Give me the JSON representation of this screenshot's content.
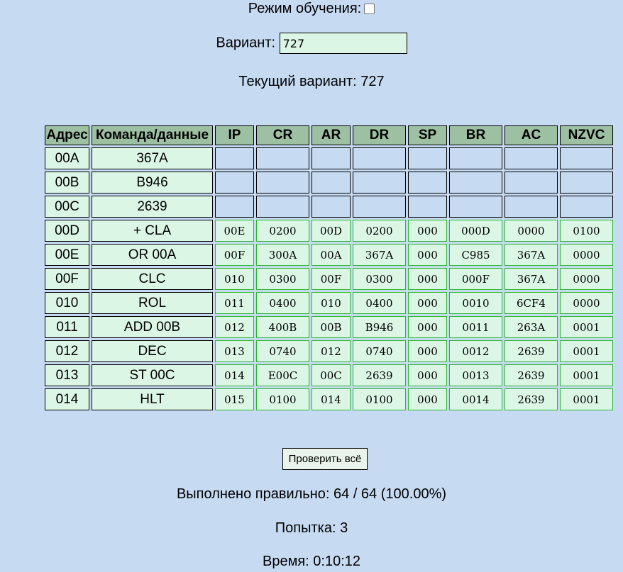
{
  "training_mode": {
    "label": "Режим обучения:",
    "checked": false
  },
  "variant": {
    "label": "Вариант:",
    "value": "727"
  },
  "current_variant": {
    "label": "Текущий вариант:",
    "value": "727"
  },
  "table": {
    "headers": [
      "Адрес",
      "Команда/данные",
      "IP",
      "CR",
      "AR",
      "DR",
      "SP",
      "BR",
      "AC",
      "NZVC"
    ],
    "rows": [
      {
        "addr": "00A",
        "cmd": "367A",
        "vals": []
      },
      {
        "addr": "00B",
        "cmd": "B946",
        "vals": []
      },
      {
        "addr": "00C",
        "cmd": "2639",
        "vals": []
      },
      {
        "addr": "00D",
        "cmd": "+ CLA",
        "vals": [
          "00E",
          "0200",
          "00D",
          "0200",
          "000",
          "000D",
          "0000",
          "0100"
        ]
      },
      {
        "addr": "00E",
        "cmd": "OR 00A",
        "vals": [
          "00F",
          "300A",
          "00A",
          "367A",
          "000",
          "C985",
          "367A",
          "0000"
        ]
      },
      {
        "addr": "00F",
        "cmd": "CLC",
        "vals": [
          "010",
          "0300",
          "00F",
          "0300",
          "000",
          "000F",
          "367A",
          "0000"
        ]
      },
      {
        "addr": "010",
        "cmd": "ROL",
        "vals": [
          "011",
          "0400",
          "010",
          "0400",
          "000",
          "0010",
          "6CF4",
          "0000"
        ]
      },
      {
        "addr": "011",
        "cmd": "ADD 00B",
        "vals": [
          "012",
          "400B",
          "00B",
          "B946",
          "000",
          "0011",
          "263A",
          "0001"
        ]
      },
      {
        "addr": "012",
        "cmd": "DEC",
        "vals": [
          "013",
          "0740",
          "012",
          "0740",
          "000",
          "0012",
          "2639",
          "0001"
        ]
      },
      {
        "addr": "013",
        "cmd": "ST 00C",
        "vals": [
          "014",
          "E00C",
          "00C",
          "2639",
          "000",
          "0013",
          "2639",
          "0001"
        ]
      },
      {
        "addr": "014",
        "cmd": "HLT",
        "vals": [
          "015",
          "0100",
          "014",
          "0100",
          "000",
          "0014",
          "2639",
          "0001"
        ]
      }
    ]
  },
  "check_button": {
    "label": "Проверить всё"
  },
  "result": {
    "label": "Выполнено правильно:",
    "value": "64 / 64 (100.00%)"
  },
  "attempt": {
    "label": "Попытка:",
    "value": "3"
  },
  "time": {
    "label": "Время:",
    "value": "0:10:12"
  }
}
